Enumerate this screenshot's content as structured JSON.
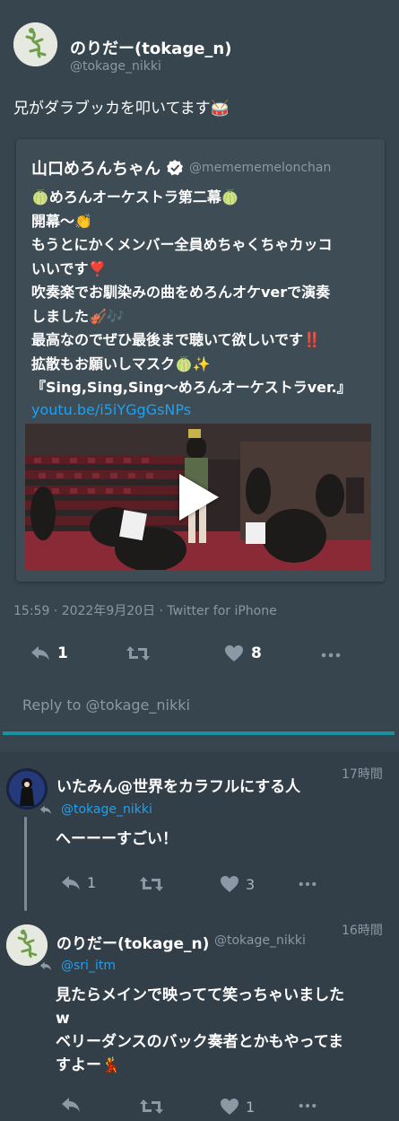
{
  "main_tweet": {
    "user_name": "のりだー(tokage_n)",
    "user_handle": "@tokage_nikki",
    "text": "兄がダラブッカを叩いてます🥁",
    "quote": {
      "user_name": "山口めろんちゃん",
      "user_handle": "@memememelonchan",
      "lines": [
        "🍈めろんオーケストラ第二幕🍈",
        "開幕〜👏",
        "もうとにかくメンバー全員めちゃくちゃカッコ",
        "いいです❣️",
        "吹奏楽でお馴染みの曲をめろんオケverで演奏",
        "しました🎻🎶",
        "最高なのでぜひ最後まで聴いて欲しいです‼️",
        "拡散もお願いしマスク🍈✨",
        "『Sing,Sing,Sing〜めろんオーケストラver.』"
      ],
      "link": "youtu.be/i5iYGgGsNPs"
    },
    "meta": "15:59 · 2022年9月20日 · Twitter for iPhone",
    "reply_count": "1",
    "like_count": "8",
    "reply_placeholder": "Reply to @tokage_nikki"
  },
  "replies": [
    {
      "user_name": "いたみん@世界をカラフルにする人",
      "time": "17時間",
      "mention": "@tokage_nikki",
      "text_lines": [
        "へーーーすごい！"
      ],
      "reply_count": "1",
      "like_count": "3"
    },
    {
      "user_name": "のりだー(tokage_n)",
      "user_handle": "@tokage_nikki",
      "time": "16時間",
      "mention": "@sri_itm",
      "text_lines": [
        "見たらメインで映ってて笑っちゃいました",
        "w",
        "ベリーダンスのバック奏者とかもやってま",
        "すよー💃"
      ],
      "reply_count": "",
      "like_count": "1"
    }
  ],
  "colors": {
    "background": "#323f48",
    "main_tweet_bg": "#37454e",
    "quote_bg": "#3e4c55",
    "link": "#1da1f2",
    "secondary_text": "#8b98a5",
    "divider": "#1a91a1"
  },
  "icons": [
    "lizard-avatar-icon",
    "verified-badge-icon",
    "play-icon",
    "reply-icon",
    "retweet-icon",
    "heart-icon",
    "more-icon"
  ]
}
